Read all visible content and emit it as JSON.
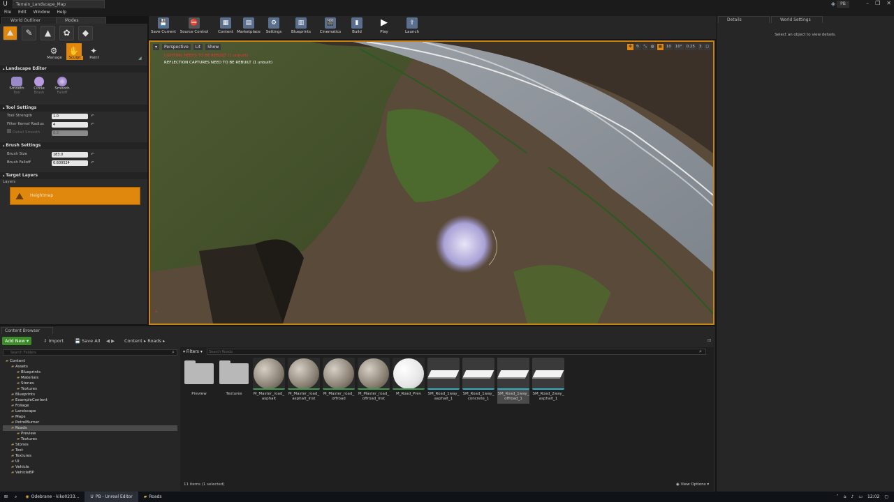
{
  "window": {
    "tab_title": "Terrain_Landscape_Map",
    "project": "PB"
  },
  "menu": [
    "File",
    "Edit",
    "Window",
    "Help"
  ],
  "left_tabs": {
    "outliner": "World Outliner",
    "modes": "Modes"
  },
  "modes": {
    "manage": "Manage",
    "sculpt": "Sculpt",
    "paint": "Paint"
  },
  "landscape_editor": {
    "title": "Landscape Editor",
    "tools": [
      {
        "label": "Smooth",
        "sub": "Tool"
      },
      {
        "label": "Circle",
        "sub": "Brush"
      },
      {
        "label": "Smooth",
        "sub": "Falloff"
      }
    ]
  },
  "tool_settings": {
    "title": "Tool Settings",
    "strength_label": "Tool Strength",
    "strength": "1.0",
    "kernel_label": "Filter Kernel Radius",
    "kernel": "4",
    "detail_label": "Detail Smooth",
    "detail": "0.3"
  },
  "brush_settings": {
    "title": "Brush Settings",
    "size_label": "Brush Size",
    "size": "183.0",
    "falloff_label": "Brush Falloff",
    "falloff": "0.609524"
  },
  "target_layers": {
    "title": "Target Layers",
    "layers_label": "Layers",
    "heightmap": "Heightmap"
  },
  "toolbar": [
    "Save Current",
    "Source Control",
    "Content",
    "Marketplace",
    "Settings",
    "Blueprints",
    "Cinematics",
    "Build",
    "Play",
    "Launch"
  ],
  "viewport": {
    "perspective": "Perspective",
    "lit": "Lit",
    "show": "Show",
    "warning_lighting": "LIGHTING NEEDS TO BE REBUILT (1 unbuilt)",
    "warning_reflection": "REFLECTION CAPTURES NEED TO BE REBUILT (1 unbuilt)",
    "grid_snap": "10",
    "rot_snap": "10°",
    "scale_snap": "0.25",
    "cam_speed": "3"
  },
  "details": {
    "tab": "Details",
    "world_tab": "World Settings",
    "empty_msg": "Select an object to view details."
  },
  "content_browser": {
    "tab": "Content Browser",
    "add_new": "Add New",
    "import": "Import",
    "save_all": "Save All",
    "path": [
      "Content",
      "Roads"
    ],
    "search_folders": "Search Folders",
    "filters": "Filters",
    "search_assets": "Search Roads",
    "status": "11 items (1 selected)",
    "view_options": "View Options",
    "tree": [
      {
        "label": "Content",
        "depth": 0
      },
      {
        "label": "Assets",
        "depth": 1
      },
      {
        "label": "Blueprints",
        "depth": 2
      },
      {
        "label": "Materials",
        "depth": 2
      },
      {
        "label": "Stones",
        "depth": 2
      },
      {
        "label": "Textures",
        "depth": 2
      },
      {
        "label": "Blueprints",
        "depth": 1
      },
      {
        "label": "ExampleContent",
        "depth": 1
      },
      {
        "label": "Foliage",
        "depth": 1
      },
      {
        "label": "Landscape",
        "depth": 1
      },
      {
        "label": "Maps",
        "depth": 1
      },
      {
        "label": "PetrolBurner",
        "depth": 1
      },
      {
        "label": "Roads",
        "depth": 1,
        "selected": true
      },
      {
        "label": "Preview",
        "depth": 2
      },
      {
        "label": "Textures",
        "depth": 2
      },
      {
        "label": "Stones",
        "depth": 1
      },
      {
        "label": "Test",
        "depth": 1
      },
      {
        "label": "Textures",
        "depth": 1
      },
      {
        "label": "UI",
        "depth": 1
      },
      {
        "label": "Vehicle",
        "depth": 1
      },
      {
        "label": "VehicleBP",
        "depth": 1
      }
    ],
    "assets": [
      {
        "label": "Preview",
        "kind": "folder"
      },
      {
        "label": "Textures",
        "kind": "folder"
      },
      {
        "label": "M_Master_road_asphalt",
        "kind": "material"
      },
      {
        "label": "M_Master_road_asphalt_Inst",
        "kind": "material"
      },
      {
        "label": "M_Master_road_offroad",
        "kind": "material"
      },
      {
        "label": "M_Master_road_offroad_Inst",
        "kind": "material"
      },
      {
        "label": "M_Road_Prev",
        "kind": "white"
      },
      {
        "label": "SM_Road_1way_asphalt_1",
        "kind": "mesh"
      },
      {
        "label": "SM_Road_1way_concrete_1",
        "kind": "mesh"
      },
      {
        "label": "SM_Road_1way_offroad_1",
        "kind": "mesh",
        "selected": true
      },
      {
        "label": "SM_Road_2way_asphalt_1",
        "kind": "mesh"
      }
    ]
  },
  "taskbar": {
    "tasks": [
      "Odebrane - kiko0233...",
      "PB - Unreal Editor",
      "Roads"
    ],
    "clock": "12:02"
  },
  "colors": {
    "accent": "#e0880e",
    "panel": "#262626",
    "viewport_border": "#c98311"
  }
}
